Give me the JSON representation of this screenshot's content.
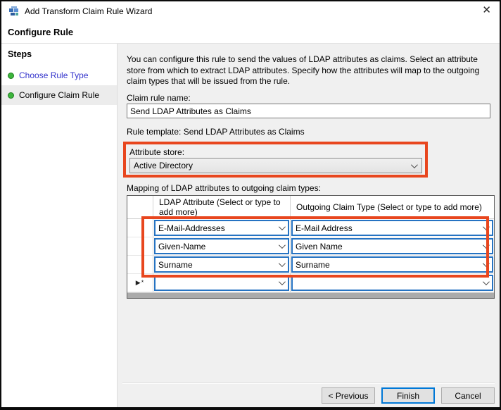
{
  "window": {
    "title": "Add Transform Claim Rule Wizard",
    "heading": "Configure Rule"
  },
  "icons": {
    "close": "✕",
    "chevron_down": "⌄",
    "app_icon": "adfs-claim-rule-wizard-icon",
    "step_bullet": "●",
    "new_row_marker": "▶*"
  },
  "steps": {
    "header": "Steps",
    "items": [
      {
        "label": "Choose Rule Type",
        "state": "completed"
      },
      {
        "label": "Configure Claim Rule",
        "state": "current"
      }
    ]
  },
  "content": {
    "description": "You can configure this rule to send the values of LDAP attributes as claims. Select an attribute store from which to extract LDAP attributes. Specify how the attributes will map to the outgoing claim types that will be issued from the rule.",
    "claim_rule_name_label": "Claim rule name:",
    "claim_rule_name_value": "Send LDAP Attributes as Claims",
    "rule_template_text": "Rule template: Send LDAP Attributes as Claims",
    "attribute_store_label": "Attribute store:",
    "attribute_store_value": "Active Directory",
    "mapping_label": "Mapping of LDAP attributes to outgoing claim types:"
  },
  "mapping_table": {
    "columns": [
      "LDAP Attribute (Select or type to add more)",
      "Outgoing Claim Type (Select or type to add more)"
    ],
    "rows": [
      {
        "ldap_attribute": "E-Mail-Addresses",
        "outgoing_claim_type": "E-Mail Address"
      },
      {
        "ldap_attribute": "Given-Name",
        "outgoing_claim_type": "Given Name"
      },
      {
        "ldap_attribute": "Surname",
        "outgoing_claim_type": "Surname"
      },
      {
        "ldap_attribute": "",
        "outgoing_claim_type": ""
      }
    ],
    "new_row_marker": "▶*"
  },
  "buttons": {
    "previous": "< Previous",
    "finish": "Finish",
    "cancel": "Cancel"
  },
  "colors": {
    "annotation_orange": "#e8461e",
    "combo_focus_border": "#2673c2",
    "finish_button_border": "#0078d7",
    "step_link_blue": "#3333cc",
    "step_bullet_green": "#3db53d",
    "content_background": "#f0f0f0",
    "table_fill_gray": "#ababab"
  }
}
